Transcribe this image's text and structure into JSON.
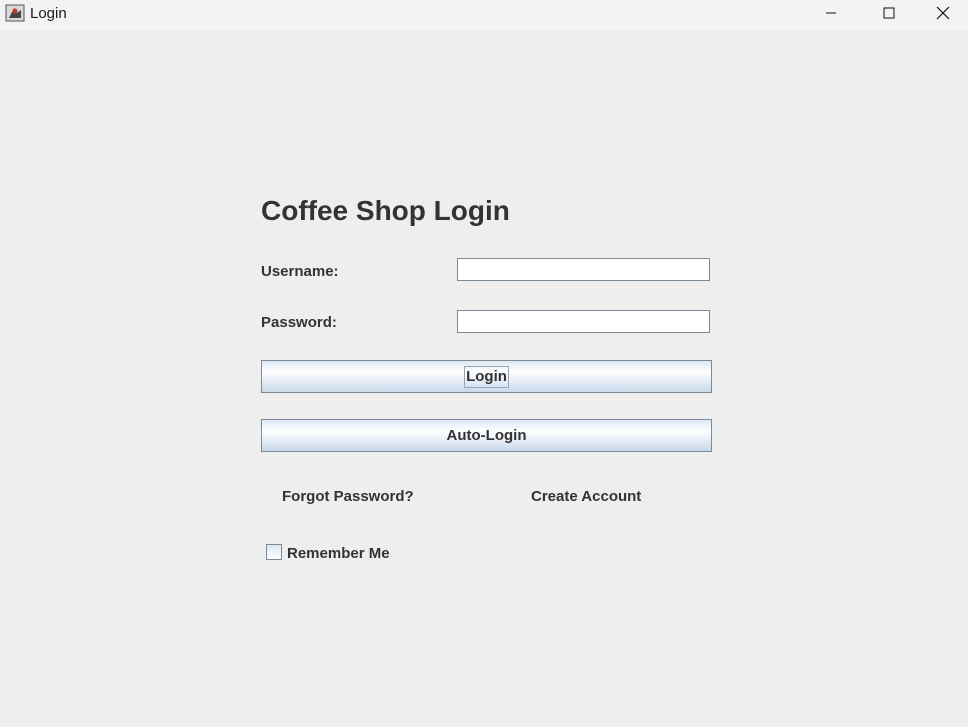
{
  "window": {
    "title": "Login",
    "icon": "java-cup-icon",
    "controls": [
      "minimize-icon",
      "maximize-icon",
      "close-icon"
    ]
  },
  "form": {
    "heading": "Coffee Shop Login",
    "username_label": "Username:",
    "username_value": "",
    "password_label": "Password:",
    "password_value": "",
    "login_button": "Login",
    "auto_login_button": "Auto-Login",
    "forgot_password_link": "Forgot Password?",
    "create_account_link": "Create Account",
    "remember_me_label": "Remember Me",
    "remember_me_checked": false
  },
  "colors": {
    "background": "#eeeeee",
    "text": "#333333",
    "button_gradient_top": "#dde8f3",
    "button_gradient_bottom": "#c8d9ea",
    "border": "#7a8a99"
  }
}
